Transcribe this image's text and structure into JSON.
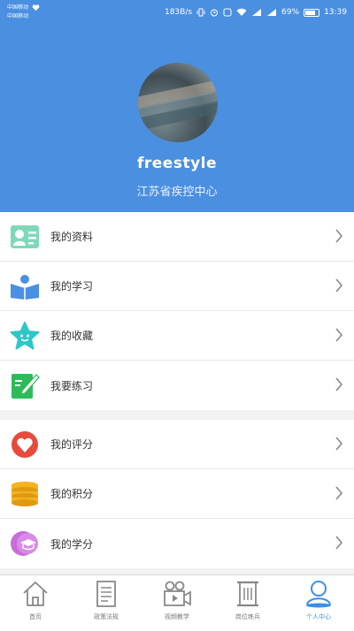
{
  "status_bar": {
    "carrier_top": "中国移动",
    "carrier_bottom": "中国移动",
    "speed": "183B/s",
    "battery": "69%",
    "time": "13:39"
  },
  "profile": {
    "username": "freestyle",
    "organization": "江苏省疾控中心"
  },
  "menu": {
    "group1": [
      {
        "label": "我的资料",
        "icon": "profile-card-icon"
      },
      {
        "label": "我的学习",
        "icon": "reading-book-icon"
      },
      {
        "label": "我的收藏",
        "icon": "star-icon"
      },
      {
        "label": "我要练习",
        "icon": "practice-edit-icon"
      }
    ],
    "group2": [
      {
        "label": "我的评分",
        "icon": "heart-shield-icon"
      },
      {
        "label": "我的积分",
        "icon": "coin-stack-icon"
      },
      {
        "label": "我的学分",
        "icon": "graduation-coin-icon"
      }
    ]
  },
  "tabbar": {
    "tabs": [
      {
        "label": "首页",
        "icon": "home-icon"
      },
      {
        "label": "政策法规",
        "icon": "document-icon"
      },
      {
        "label": "视频教学",
        "icon": "video-camera-icon"
      },
      {
        "label": "岗位练兵",
        "icon": "scroll-icon"
      },
      {
        "label": "个人中心",
        "icon": "person-icon"
      }
    ],
    "active": "个人中心"
  },
  "colors": {
    "header": "#4a8fe0",
    "tab_active": "#3a8fe6"
  }
}
